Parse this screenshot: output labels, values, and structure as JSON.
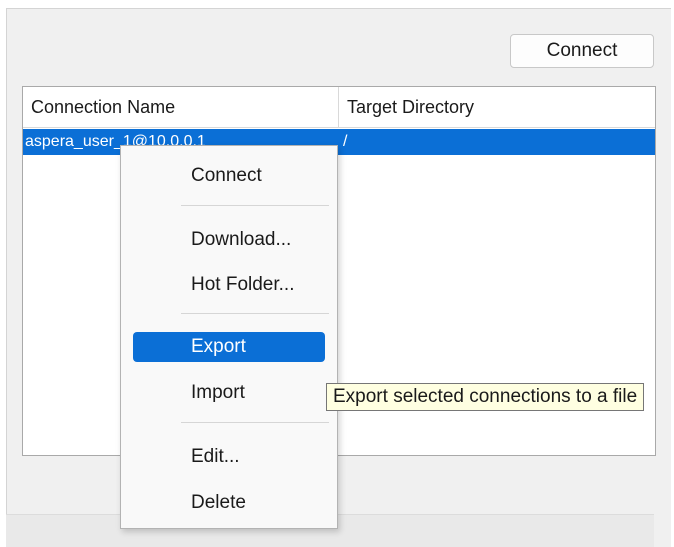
{
  "toolbar": {
    "connect_label": "Connect"
  },
  "table": {
    "columns": [
      "Connection Name",
      "Target Directory"
    ],
    "rows": [
      {
        "name": "aspera_user_1@10.0.0.1",
        "target": "/"
      }
    ]
  },
  "context_menu": {
    "items": [
      "Connect",
      "Download...",
      "Hot Folder...",
      "Export",
      "Import",
      "Edit...",
      "Delete"
    ],
    "highlighted": "Export"
  },
  "tooltip": {
    "text": "Export selected connections to a file"
  },
  "colors": {
    "selection": "#0b6fd6",
    "tooltip_bg": "#ffffe1",
    "panel_bg": "#f0f0f0"
  }
}
